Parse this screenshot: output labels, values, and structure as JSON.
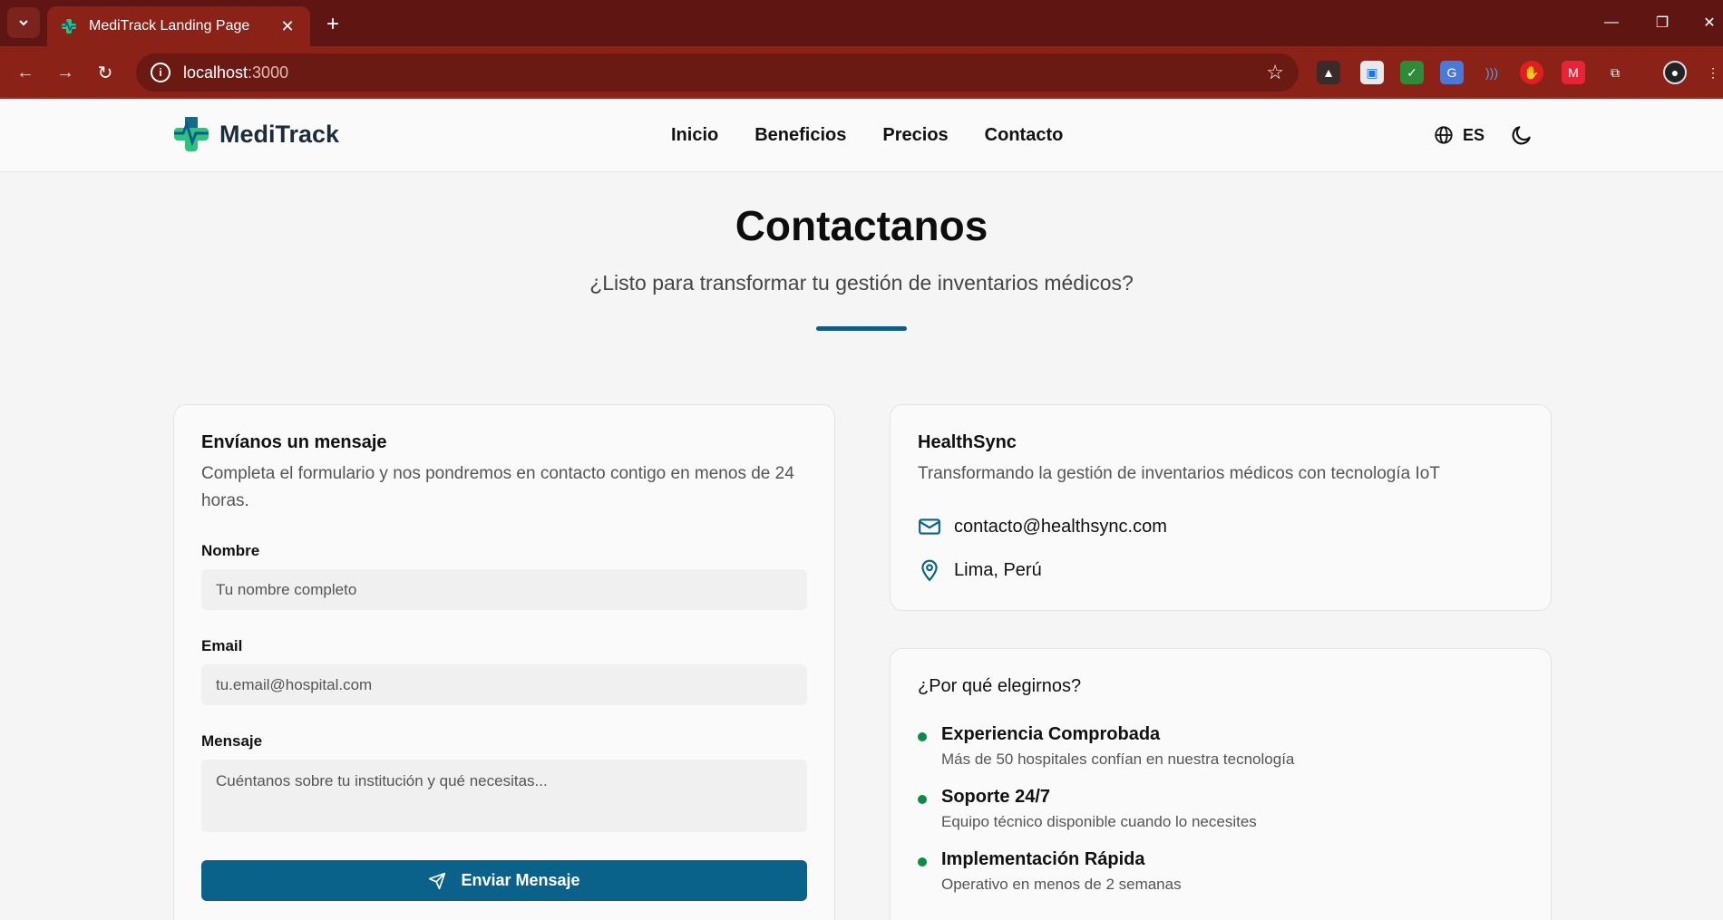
{
  "browser": {
    "tab_title": "MediTrack Landing Page",
    "url_host": "localhost",
    "url_port": ":3000"
  },
  "header": {
    "brand": "MediTrack",
    "nav": [
      "Inicio",
      "Beneficios",
      "Precios",
      "Contacto"
    ],
    "language": "ES"
  },
  "hero": {
    "title": "Contactanos",
    "subtitle": "¿Listo para transformar tu gestión de inventarios médicos?"
  },
  "form": {
    "title": "Envíanos un mensaje",
    "description": "Completa el formulario y nos pondremos en contacto contigo en menos de 24 horas.",
    "name_label": "Nombre",
    "name_placeholder": "Tu nombre completo",
    "email_label": "Email",
    "email_placeholder": "tu.email@hospital.com",
    "message_label": "Mensaje",
    "message_placeholder": "Cuéntanos sobre tu institución y qué necesitas...",
    "submit_label": "Enviar Mensaje"
  },
  "company": {
    "name": "HealthSync",
    "tagline": "Transformando la gestión de inventarios médicos con tecnología IoT",
    "email": "contacto@healthsync.com",
    "location": "Lima, Perú"
  },
  "why": {
    "title": "¿Por qué elegirnos?",
    "items": [
      {
        "title": "Experiencia Comprobada",
        "desc": "Más de 50 hospitales confían en nuestra tecnología"
      },
      {
        "title": "Soporte 24/7",
        "desc": "Equipo técnico disponible cuando lo necesites"
      },
      {
        "title": "Implementación Rápida",
        "desc": "Operativo en menos de 2 semanas"
      }
    ]
  },
  "colors": {
    "primary": "#0a6189",
    "accent_green": "#0c8a4a",
    "browser_frame": "#5f1612"
  }
}
